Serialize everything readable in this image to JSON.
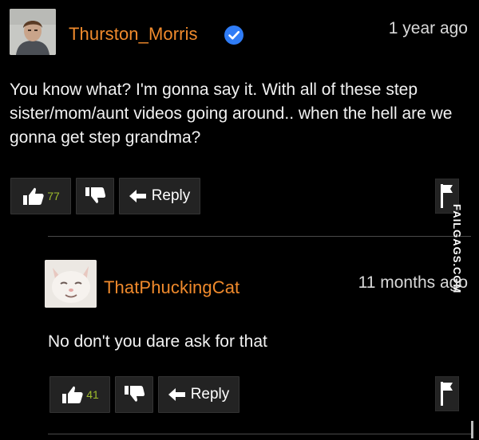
{
  "comments": [
    {
      "username": "Thurston_Morris",
      "verified": true,
      "timestamp": "1 year ago",
      "text": "You know what? I'm gonna say it. With all of these step sister/mom/aunt videos going around.. when the hell are we gonna get step grandma?",
      "likes": "77",
      "reply_label": "Reply"
    },
    {
      "username": "ThatPhuckingCat",
      "verified": false,
      "timestamp": "11 months ago",
      "text": "No don't you dare ask for that",
      "likes": "41",
      "reply_label": "Reply"
    }
  ],
  "watermark": "FAILGAGS.COM",
  "colors": {
    "username": "#f08a2c",
    "like_count": "#9dbb2c",
    "verified_badge": "#2f7cf6",
    "button_bg": "#232323"
  },
  "icons": [
    "thumbs-up-icon",
    "thumbs-down-icon",
    "reply-arrow-icon",
    "flag-icon",
    "verified-check-icon"
  ]
}
